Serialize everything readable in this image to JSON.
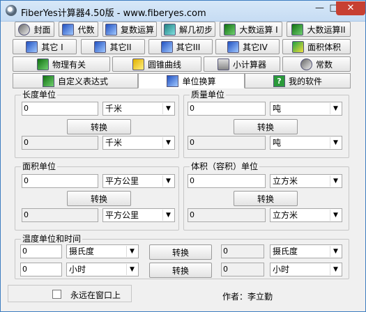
{
  "window": {
    "title": "FiberYes计算器4.50版 - www.fiberyes.com",
    "controls": {
      "minimize": "—",
      "maximize": "□",
      "close": "✕"
    }
  },
  "toolbar": {
    "row1": [
      {
        "label": "封面",
        "icon": "disc-icon"
      },
      {
        "label": "代数",
        "icon": "algebra-icon"
      },
      {
        "label": "复数运算",
        "icon": "info-icon"
      },
      {
        "label": "解几初步",
        "icon": "axes-icon"
      },
      {
        "label": "大数运算 I",
        "icon": "bignum-icon"
      },
      {
        "label": "大数运算II",
        "icon": "bignum-icon"
      }
    ],
    "row2": [
      {
        "label": "其它 I",
        "icon": "chart-icon"
      },
      {
        "label": "其它II",
        "icon": "chart-icon"
      },
      {
        "label": "其它III",
        "icon": "chart-icon"
      },
      {
        "label": "其它IV",
        "icon": "chart-icon"
      },
      {
        "label": "面积体积",
        "icon": "triangle-icon"
      }
    ],
    "row3": [
      {
        "label": "物理有关",
        "icon": "physics-icon"
      },
      {
        "label": "圆锥曲线",
        "icon": "curve-icon"
      },
      {
        "label": "小计算器",
        "icon": "calculator-icon"
      },
      {
        "label": "常数",
        "icon": "disc-icon"
      }
    ]
  },
  "tabs": [
    {
      "label": "自定义表达式",
      "active": false
    },
    {
      "label": "单位换算",
      "active": true
    },
    {
      "label": "我的软件",
      "active": false
    }
  ],
  "length": {
    "title": "长度单位",
    "input_value": "0",
    "input_unit": "千米",
    "convert_label": "转换",
    "output_value": "0",
    "output_unit": "千米"
  },
  "mass": {
    "title": "质量单位",
    "input_value": "0",
    "input_unit": "吨",
    "convert_label": "转换",
    "output_value": "0",
    "output_unit": "吨"
  },
  "area": {
    "title": "面积单位",
    "input_value": "0",
    "input_unit": "平方公里",
    "convert_label": "转换",
    "output_value": "0",
    "output_unit": "平方公里"
  },
  "volume": {
    "title": "体积（容积）单位",
    "input_value": "0",
    "input_unit": "立方米",
    "convert_label": "转换",
    "output_value": "0",
    "output_unit": "立方米"
  },
  "temp_time": {
    "title": "温度单位和时间",
    "temp_input_value": "0",
    "temp_input_unit": "摄氏度",
    "temp_convert_label": "转换",
    "temp_output_value": "0",
    "temp_output_unit": "摄氏度",
    "time_input_value": "0",
    "time_input_unit": "小时",
    "time_convert_label": "转换",
    "time_output_value": "0",
    "time_output_unit": "小时"
  },
  "footer": {
    "always_on_top_label": "永远在窗口上",
    "author_label": "作者：李立勤"
  }
}
